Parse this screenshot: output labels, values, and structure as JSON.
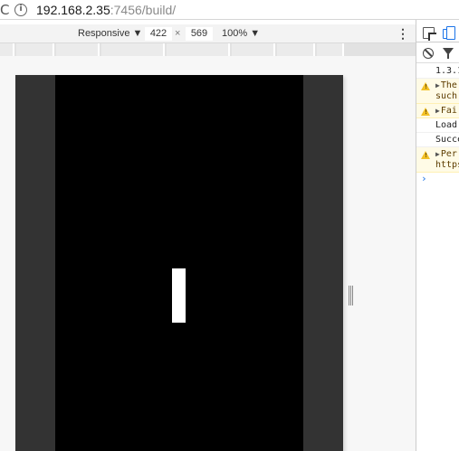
{
  "address_bar": {
    "reload_glyph": "C",
    "url_host": "192.168.2.35",
    "url_rest": ":7456/build/"
  },
  "device_toolbar": {
    "device": "Responsive ▼",
    "width": "422",
    "times": "×",
    "height": "569",
    "zoom": "100% ▼",
    "menu": "⋮"
  },
  "game": {
    "canvas_color": "#000000",
    "frame_color": "#333333",
    "paddle_color": "#ffffff"
  },
  "devtools": {
    "tabs": [
      {
        "icon": "inspect-element-icon"
      },
      {
        "icon": "toggle-device-toolbar-icon",
        "active": true,
        "color": "#1a73e8"
      }
    ],
    "console": {
      "lines": [
        {
          "type": "log",
          "text": "1.3.1"
        },
        {
          "type": "warning",
          "text": "The",
          "text2": "such",
          "expandable": true
        },
        {
          "type": "warning",
          "text": "Fai",
          "expandable": true
        },
        {
          "type": "log",
          "text": "Load"
        },
        {
          "type": "log",
          "text": "Succe"
        },
        {
          "type": "warning",
          "text": "Per",
          "text2": "https",
          "expandable": true
        }
      ],
      "prompt": "›"
    }
  }
}
